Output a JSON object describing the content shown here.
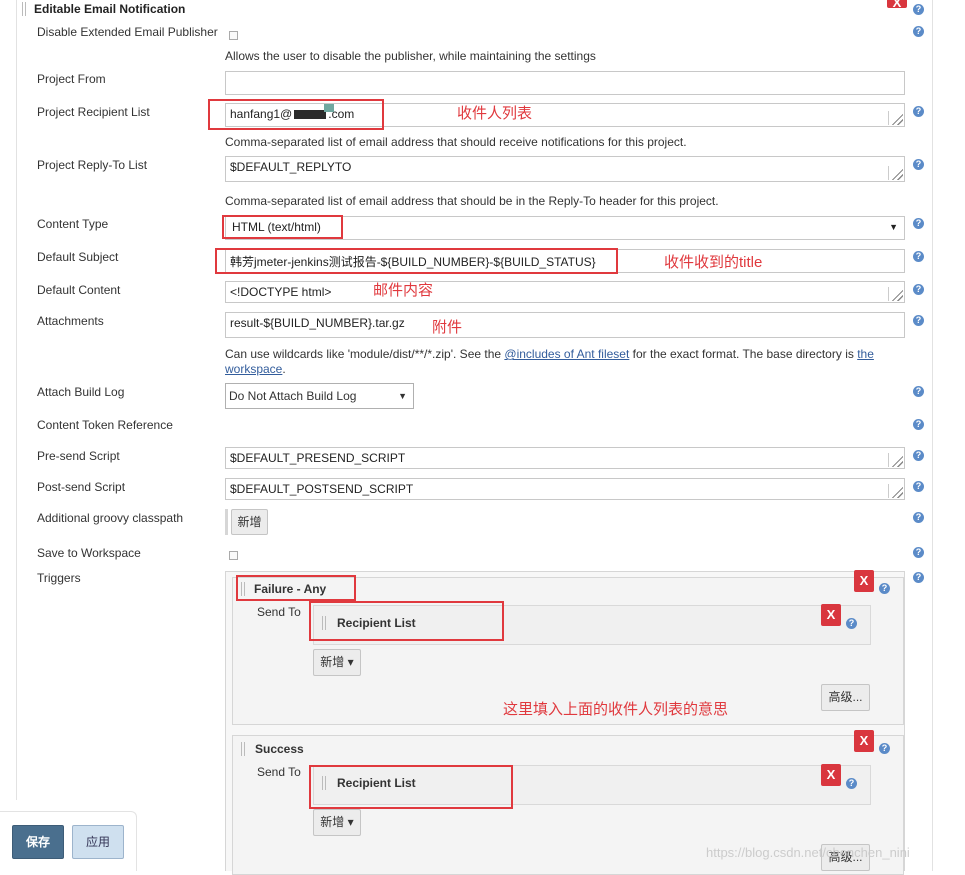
{
  "section": {
    "title": "Editable Email Notification"
  },
  "fields": {
    "disable_publisher": {
      "label": "Disable Extended Email Publisher",
      "desc": "Allows the user to disable the publisher, while maintaining the settings"
    },
    "project_from": {
      "label": "Project From",
      "value": ""
    },
    "recipient_list": {
      "label": "Project Recipient List",
      "value": "hanfang1@",
      "value_tail": ".com",
      "desc": "Comma-separated list of email address that should receive notifications for this project."
    },
    "reply_to": {
      "label": "Project Reply-To List",
      "value": "$DEFAULT_REPLYTO",
      "desc": "Comma-separated list of email address that should be in the Reply-To header for this project."
    },
    "content_type": {
      "label": "Content Type",
      "value": "HTML (text/html)"
    },
    "default_subject": {
      "label": "Default Subject",
      "value": "韩芳jmeter-jenkins测试报告-${BUILD_NUMBER}-${BUILD_STATUS}"
    },
    "default_content": {
      "label": "Default Content",
      "value": "<!DOCTYPE html>"
    },
    "attachments": {
      "label": "Attachments",
      "value": "result-${BUILD_NUMBER}.tar.gz",
      "desc_part1": "Can use wildcards like 'module/dist/**/*.zip'. See the ",
      "desc_link1": "@includes of Ant fileset",
      "desc_part2": " for the exact format. The base directory is ",
      "desc_link2a": "the",
      "desc_link2b": "workspace",
      "desc_end": "."
    },
    "attach_build_log": {
      "label": "Attach Build Log",
      "value": "Do Not Attach Build Log"
    },
    "content_token_reference": {
      "label": "Content Token Reference"
    },
    "presend_script": {
      "label": "Pre-send Script",
      "value": "$DEFAULT_PRESEND_SCRIPT"
    },
    "postsend_script": {
      "label": "Post-send Script",
      "value": "$DEFAULT_POSTSEND_SCRIPT"
    },
    "groovy_classpath": {
      "label": "Additional groovy classpath",
      "button": "新增"
    },
    "save_to_workspace": {
      "label": "Save to Workspace"
    },
    "triggers": {
      "label": "Triggers"
    }
  },
  "triggers": [
    {
      "name": "Failure - Any",
      "send_to_label": "Send To",
      "recipient": "Recipient List",
      "add_button": "新增",
      "advanced_button": "高级..."
    },
    {
      "name": "Success",
      "send_to_label": "Send To",
      "recipient": "Recipient List",
      "add_button": "新增",
      "advanced_button": "高级..."
    }
  ],
  "annotations": {
    "recipient": "收件人列表",
    "subject": "收件收到的title",
    "content": "邮件内容",
    "attachment": "附件",
    "trigger": "这里填入上面的收件人列表的意思"
  },
  "footer": {
    "save": "保存",
    "apply": "应用"
  },
  "watermark": "https://blog.csdn.net/chenchen_nini",
  "icons": {
    "help": "help-icon",
    "delete": "x",
    "dropdown": "▼",
    "caret": "▾"
  },
  "colors": {
    "annotation_red": "#e0393e",
    "delete_red": "#d9363e",
    "save_blue": "#4a6f8e",
    "link_blue": "#335d9c"
  }
}
